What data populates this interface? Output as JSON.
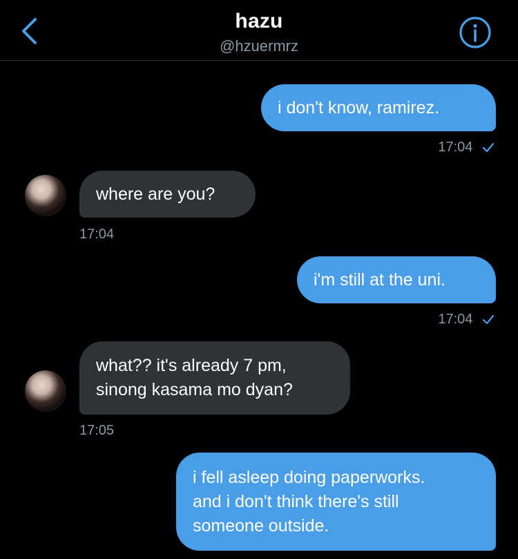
{
  "header": {
    "title": "hazu",
    "handle": "@hzuermrz",
    "back_icon": "chevron-left-icon",
    "info_icon": "info-circle-icon",
    "accent_color": "#4a9ee8"
  },
  "messages": [
    {
      "direction": "sent",
      "text": "i don't know, ramirez.",
      "time": "17:04",
      "read_icon": "checkmark-icon"
    },
    {
      "direction": "received",
      "text": "where are you?",
      "time": "17:04"
    },
    {
      "direction": "sent",
      "text": "i'm still at the uni.",
      "time": "17:04",
      "read_icon": "checkmark-icon"
    },
    {
      "direction": "received",
      "lines": [
        "what?? it's already 7 pm,",
        "sinong kasama mo dyan?"
      ],
      "time": "17:05"
    },
    {
      "direction": "sent",
      "lines": [
        "i fell asleep doing paperworks.",
        "and i don't think there's still",
        "someone outside."
      ]
    }
  ],
  "colors": {
    "sent_bubble": "#4a9ee8",
    "received_bubble": "#2f3336",
    "timestamp": "#8899a6",
    "background": "#000000"
  }
}
